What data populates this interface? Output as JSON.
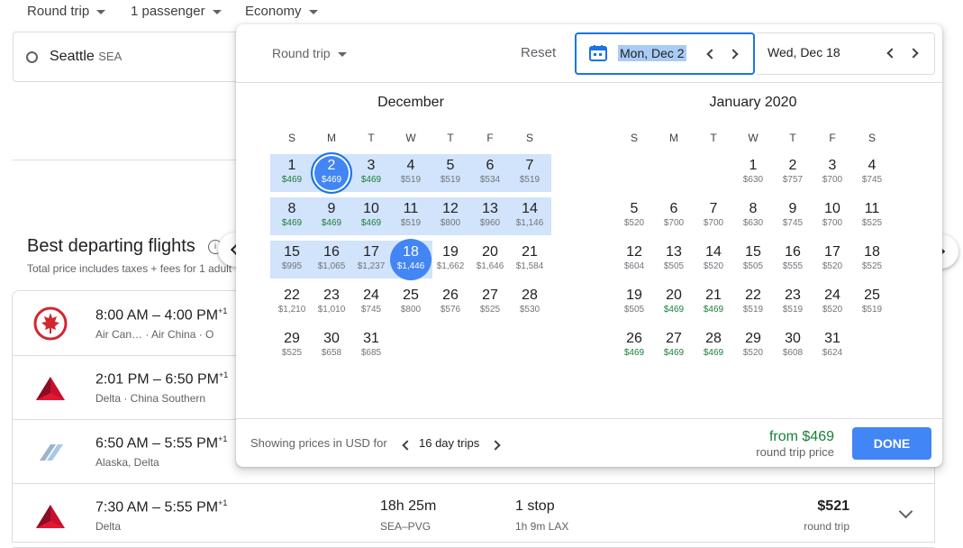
{
  "top": {
    "trip_type": "Round trip",
    "passengers": "1 passenger",
    "cabin": "Economy"
  },
  "origin": {
    "city": "Seattle",
    "code": "SEA"
  },
  "best": {
    "title": "Best departing flights",
    "subtitle": "Total price includes taxes + fees for 1 adult"
  },
  "flights": [
    {
      "times": "8:00 AM – 4:00 PM",
      "plus": "+1",
      "airlines": "Air Can…   ·   Air China   ·   O",
      "duration": "",
      "route": "",
      "stops": "",
      "layover": "",
      "price": "",
      "ptype": "",
      "logo": "air-canada-logo"
    },
    {
      "times": "2:01 PM – 6:50 PM",
      "plus": "+1",
      "airlines": "Delta   ·   China Southern",
      "duration": "",
      "route": "",
      "stops": "",
      "layover": "",
      "price": "",
      "ptype": "",
      "logo": "delta-logo"
    },
    {
      "times": "6:50 AM – 5:55 PM",
      "plus": "+1",
      "airlines": "Alaska, Delta",
      "duration": "",
      "route": "",
      "stops": "",
      "layover": "",
      "price": "",
      "ptype": "",
      "logo": "alaska-logo"
    },
    {
      "times": "7:30 AM – 5:55 PM",
      "plus": "+1",
      "airlines": "Delta",
      "duration": "18h 25m",
      "route": "SEA–PVG",
      "stops": "1 stop",
      "layover": "1h 9m LAX",
      "price": "$521",
      "ptype": "round trip",
      "logo": "delta-logo"
    }
  ],
  "panel": {
    "trip_type": "Round trip",
    "reset": "Reset",
    "depart": "Mon, Dec 2",
    "return": "Wed, Dec 18",
    "dow": [
      "S",
      "M",
      "T",
      "W",
      "T",
      "F",
      "S"
    ],
    "months": [
      {
        "title": "December",
        "first_col": 0,
        "days": [
          [
            "1",
            "$469",
            1
          ],
          [
            "2",
            "$469",
            1
          ],
          [
            "3",
            "$469",
            1
          ],
          [
            "4",
            "$519",
            0
          ],
          [
            "5",
            "$519",
            0
          ],
          [
            "6",
            "$534",
            0
          ],
          [
            "7",
            "$519",
            0
          ],
          [
            "8",
            "$469",
            1
          ],
          [
            "9",
            "$469",
            1
          ],
          [
            "10",
            "$469",
            1
          ],
          [
            "11",
            "$519",
            0
          ],
          [
            "12",
            "$800",
            0
          ],
          [
            "13",
            "$960",
            0
          ],
          [
            "14",
            "$1,146",
            0
          ],
          [
            "15",
            "$995",
            0
          ],
          [
            "16",
            "$1,065",
            0
          ],
          [
            "17",
            "$1,237",
            0
          ],
          [
            "18",
            "$1,446",
            0
          ],
          [
            "19",
            "$1,662",
            0
          ],
          [
            "20",
            "$1,646",
            0
          ],
          [
            "21",
            "$1,584",
            0
          ],
          [
            "22",
            "$1,210",
            0
          ],
          [
            "23",
            "$1,010",
            0
          ],
          [
            "24",
            "$745",
            0
          ],
          [
            "25",
            "$800",
            0
          ],
          [
            "26",
            "$576",
            0
          ],
          [
            "27",
            "$525",
            0
          ],
          [
            "28",
            "$530",
            0
          ],
          [
            "29",
            "$525",
            0
          ],
          [
            "30",
            "$658",
            0
          ],
          [
            "31",
            "$685",
            0
          ]
        ]
      },
      {
        "title": "January 2020",
        "first_col": 3,
        "days": [
          [
            "1",
            "$630",
            0
          ],
          [
            "2",
            "$757",
            0
          ],
          [
            "3",
            "$700",
            0
          ],
          [
            "4",
            "$745",
            0
          ],
          [
            "5",
            "$520",
            0
          ],
          [
            "6",
            "$700",
            0
          ],
          [
            "7",
            "$700",
            0
          ],
          [
            "8",
            "$630",
            0
          ],
          [
            "9",
            "$745",
            0
          ],
          [
            "10",
            "$700",
            0
          ],
          [
            "11",
            "$525",
            0
          ],
          [
            "12",
            "$604",
            0
          ],
          [
            "13",
            "$505",
            0
          ],
          [
            "14",
            "$520",
            0
          ],
          [
            "15",
            "$505",
            0
          ],
          [
            "16",
            "$555",
            0
          ],
          [
            "17",
            "$520",
            0
          ],
          [
            "18",
            "$525",
            0
          ],
          [
            "19",
            "$505",
            0
          ],
          [
            "20",
            "$469",
            1
          ],
          [
            "21",
            "$469",
            1
          ],
          [
            "22",
            "$519",
            0
          ],
          [
            "23",
            "$519",
            0
          ],
          [
            "24",
            "$520",
            0
          ],
          [
            "25",
            "$519",
            0
          ],
          [
            "26",
            "$469",
            1
          ],
          [
            "27",
            "$469",
            1
          ],
          [
            "28",
            "$469",
            1
          ],
          [
            "29",
            "$520",
            0
          ],
          [
            "30",
            "$608",
            0
          ],
          [
            "31",
            "$624",
            0
          ]
        ]
      }
    ],
    "footer": {
      "showing": "Showing prices in USD for",
      "trips": "16 day trips",
      "from": "from $469",
      "rt_price": "round trip price",
      "done": "DONE"
    }
  },
  "colors": {
    "accent": "#4285f4",
    "range": "#d2e3fc",
    "low_price": "#188038"
  },
  "icons": [
    "calendar-icon",
    "chevron-left-icon",
    "chevron-right-icon",
    "info-icon",
    "dropdown-caret-icon",
    "expand-icon"
  ]
}
